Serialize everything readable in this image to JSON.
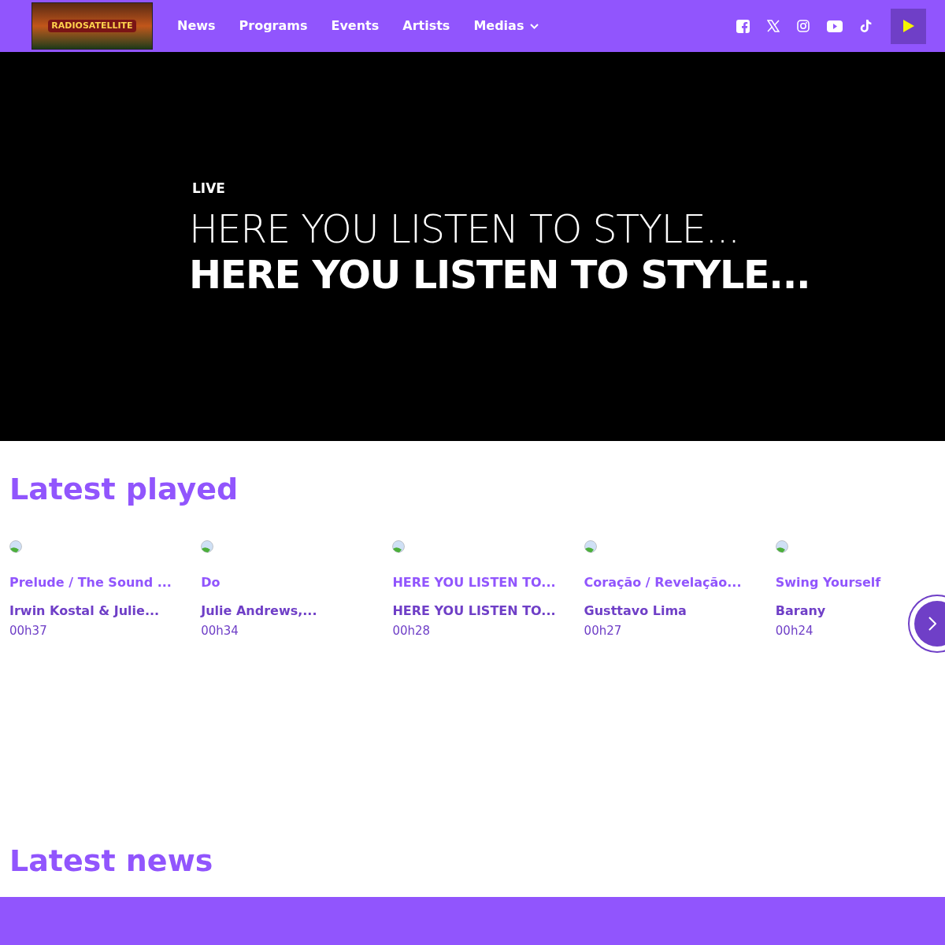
{
  "header": {
    "logo": {
      "text": "RADIOSATELLITE"
    },
    "nav": [
      {
        "label": "News",
        "dropdown": false
      },
      {
        "label": "Programs",
        "dropdown": false
      },
      {
        "label": "Events",
        "dropdown": false
      },
      {
        "label": "Artists",
        "dropdown": false
      },
      {
        "label": "Medias",
        "dropdown": true
      }
    ],
    "social": [
      {
        "kind": "facebook"
      },
      {
        "kind": "x"
      },
      {
        "kind": "instagram"
      },
      {
        "kind": "youtube"
      },
      {
        "kind": "tiktok"
      }
    ]
  },
  "hero": {
    "badge": "LIVE",
    "title_light": "HERE YOU LISTEN TO STYLE...",
    "title_bold": "HERE YOU LISTEN TO STYLE..."
  },
  "latest_played": {
    "heading": "Latest played",
    "tracks": [
      {
        "title": "Prelude / The Sound ...",
        "artist": "Irwin Kostal & Julie...",
        "time": "00h37"
      },
      {
        "title": "Do",
        "artist": "Julie Andrews,...",
        "time": "00h34"
      },
      {
        "title": "HERE YOU LISTEN TO...",
        "artist": "HERE YOU LISTEN TO...",
        "time": "00h28"
      },
      {
        "title": "Coração / Revelação...",
        "artist": "Gusttavo Lima",
        "time": "00h27"
      },
      {
        "title": "Swing Yourself",
        "artist": "Barany",
        "time": "00h24"
      }
    ]
  },
  "latest_news": {
    "heading": "Latest news"
  }
}
